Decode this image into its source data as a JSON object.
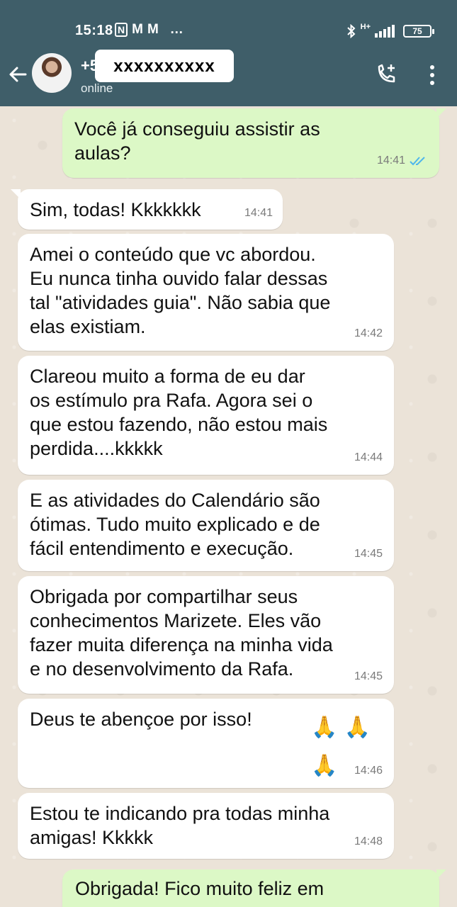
{
  "status_bar": {
    "time": "15:18",
    "left_icons": [
      "N",
      "M",
      "M",
      "…"
    ],
    "network": "H+",
    "battery": "75"
  },
  "header": {
    "contact_prefix": "+5",
    "contact_masked": "xxxxxxxxxx",
    "contact_status": "online",
    "colors": {
      "header_bg": "#3f5e69",
      "outgoing_bubble": "#dcf8c6",
      "incoming_bubble": "#ffffff",
      "read_ticks": "#4fb6ec"
    }
  },
  "messages": [
    {
      "dir": "out",
      "text": "Você já conseguiu assistir as\naulas?",
      "time": "14:41",
      "read": true
    },
    {
      "dir": "in",
      "text": "Sim, todas! Kkkkkkk",
      "time": "14:41"
    },
    {
      "dir": "in",
      "text": "Amei o conteúdo que vc abordou.\nEu nunca tinha ouvido falar dessas\ntal \"atividades guia\". Não sabia que\nelas existiam.",
      "time": "14:42"
    },
    {
      "dir": "in",
      "text": "Clareou muito a forma de eu dar\nos estímulo pra Rafa. Agora sei o\nque estou fazendo, não estou mais\nperdida....kkkkk",
      "time": "14:44"
    },
    {
      "dir": "in",
      "text": "E as atividades do Calendário são\nótimas. Tudo muito explicado e de\nfácil entendimento e execução.",
      "time": "14:45"
    },
    {
      "dir": "in",
      "text": "Obrigada por compartilhar seus\nconhecimentos Marizete. Eles vão\nfazer muita diferença na minha vida\ne no desenvolvimento da Rafa.",
      "time": "14:45"
    },
    {
      "dir": "in",
      "text": "Deus te abençoe por isso!",
      "emoji": "🙏 🙏\n🙏",
      "time": "14:46"
    },
    {
      "dir": "in",
      "text": "Estou te indicando pra todas minha\namigas! Kkkkk",
      "time": "14:48"
    },
    {
      "dir": "out",
      "text": "Obrigada! Fico muito feliz em"
    }
  ]
}
